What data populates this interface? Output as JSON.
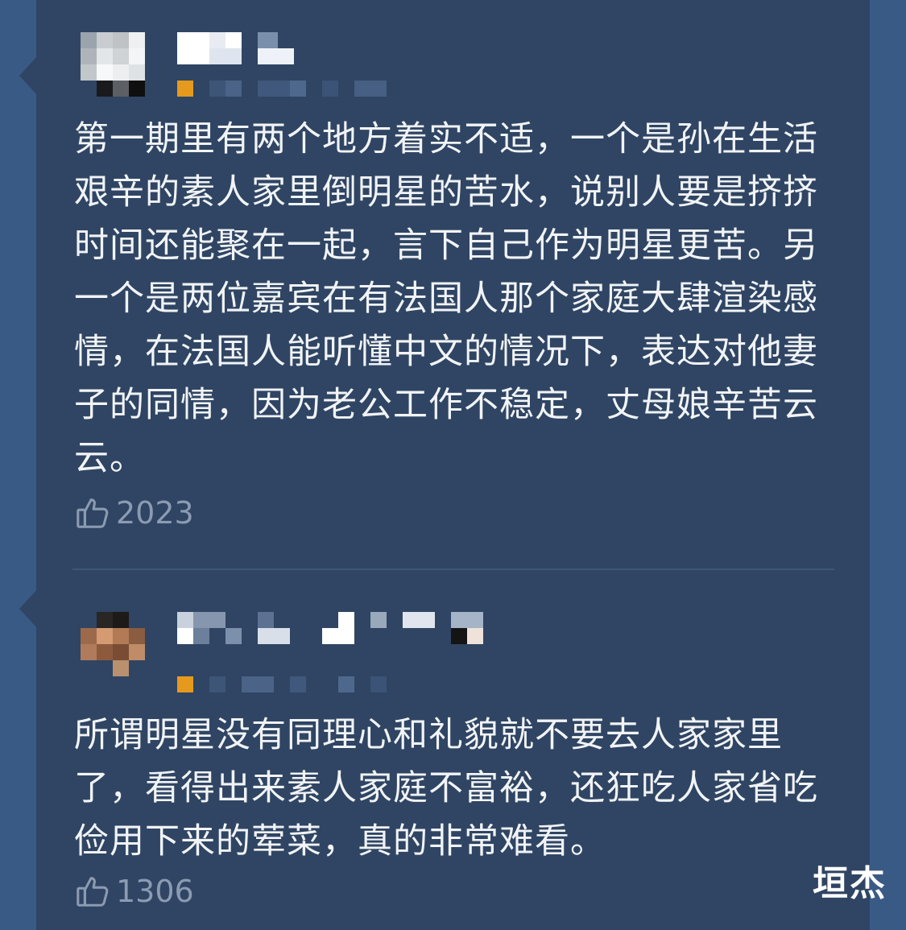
{
  "comments": [
    {
      "text": "第一期里有两个地方着实不适，一个是孙在生活艰辛的素人家里倒明星的苦水，说别人要是挤挤时间还能聚在一起，言下自己作为明星更苦。另一个是两位嘉宾在有法国人那个家庭大肆渲染感情，在法国人能听懂中文的情况下，表达对他妻子的同情，因为老公工作不稳定，丈母娘辛苦云云。",
      "likes": "2023"
    },
    {
      "text": "所谓明星没有同理心和礼貌就不要去人家家里了，看得出来素人家庭不富裕，还狂吃人家省吃俭用下来的荤菜，真的非常难看。",
      "likes": "1306"
    }
  ],
  "watermark": "垣杰",
  "colors": {
    "background": "#3a5a86",
    "panel": "#2f4563",
    "text": "#f1f3f6",
    "like": "#8b9bb2",
    "level_badge": "#e59a1e"
  },
  "icons": {
    "like": "thumbs-up-icon"
  }
}
